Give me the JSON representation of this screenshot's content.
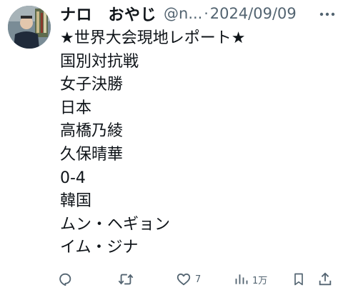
{
  "tweet": {
    "display_name": "ナロ　おやじ",
    "handle": "@n...",
    "separator": "·",
    "date": "2024/09/09",
    "lines": [
      "★世界大会現地レポート★",
      "国別対抗戦",
      "女子決勝",
      "日本",
      "高橋乃綾",
      "久保晴華",
      "0-4",
      "韓国",
      "ムン・ヘギョン",
      "イム・ジナ"
    ]
  },
  "actions": {
    "reply": {
      "icon": "reply-icon",
      "count": ""
    },
    "retweet": {
      "icon": "retweet-icon",
      "count": ""
    },
    "like": {
      "icon": "heart-icon",
      "count": "7"
    },
    "views": {
      "icon": "views-icon",
      "count": "1万"
    },
    "bookmark": {
      "icon": "bookmark-icon"
    },
    "share": {
      "icon": "share-icon"
    }
  },
  "colors": {
    "text": "#0f1419",
    "secondary": "#536471"
  }
}
